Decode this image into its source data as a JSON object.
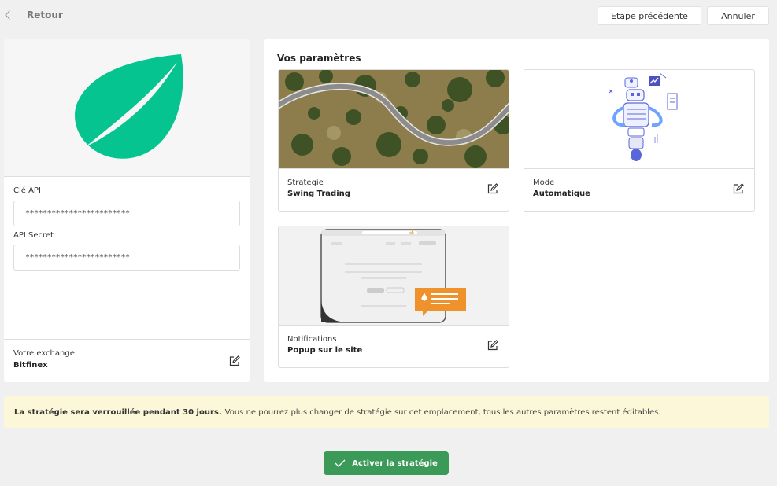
{
  "header": {
    "back_label": "Retour",
    "prev_button": "Etape précédente",
    "cancel_button": "Annuler"
  },
  "left_panel": {
    "logo_icon": "bitfinex-leaf-logo",
    "api_key_label": "Clé API",
    "api_key_value": "************************",
    "api_secret_label": "API Secret",
    "api_secret_value": "************************",
    "exchange_label": "Votre exchange",
    "exchange_value": "Bitfinex"
  },
  "right_panel": {
    "title": "Vos paramètres",
    "cards": [
      {
        "label": "Strategie",
        "value": "Swing Trading",
        "image": "winding-road-aerial"
      },
      {
        "label": "Mode",
        "value": "Automatique",
        "image": "robot-illustration"
      },
      {
        "label": "Notifications",
        "value": "Popup sur le site",
        "image": "popup-illustration"
      }
    ]
  },
  "notice": {
    "bold": "La stratégie sera verrouillée pendant 30 jours.",
    "text": "Vous ne pourrez plus changer de stratégie sur cet emplacement, tous les autres paramètres restent éditables."
  },
  "activate_button": "Activer la stratégie",
  "colors": {
    "brand_green": "#16b157",
    "leaf_green": "#06c48f",
    "activate_green": "#3c9a59",
    "notice_bg": "#fdf7d9",
    "popup_orange": "#f0922b"
  }
}
